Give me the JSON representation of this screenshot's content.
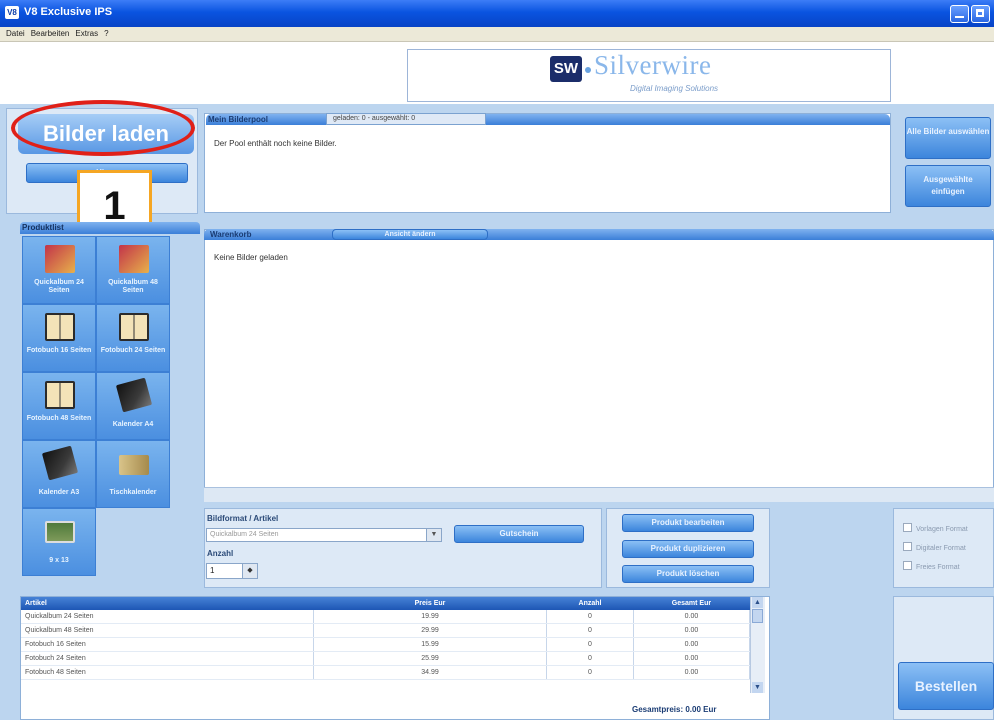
{
  "window": {
    "title": "V8 Exclusive IPS",
    "icon_text": "V8"
  },
  "menu": [
    "Datei",
    "Bearbeiten",
    "Extras",
    "?"
  ],
  "logo": {
    "mark": "SW",
    "name": "Silverwire",
    "tagline": "Digital Imaging Solutions"
  },
  "left_panel": {
    "load_button": "Bilder laden",
    "add_button": "Hinzu",
    "step_badge": "1"
  },
  "product_list": {
    "header": "Produktlist",
    "items": [
      {
        "label": "Quickalbum 24 Seiten",
        "icon": "album-icon"
      },
      {
        "label": "Quickalbum 48 Seiten",
        "icon": "album-icon"
      },
      {
        "label": "Fotobuch 16 Seiten",
        "icon": "photobook-icon"
      },
      {
        "label": "Fotobuch 24 Seiten",
        "icon": "photobook-icon"
      },
      {
        "label": "Fotobuch 48 Seiten",
        "icon": "photobook-icon"
      },
      {
        "label": "Kalender A4",
        "icon": "calendar-icon"
      },
      {
        "label": "Kalender A3",
        "icon": "calendar-icon"
      },
      {
        "label": "Tischkalender",
        "icon": "desk-calendar-icon"
      },
      {
        "label": "9 x 13",
        "icon": "photo-print-icon"
      }
    ]
  },
  "pool": {
    "tab": "Mein Bilderpool",
    "status": "geladen: 0 - ausgewählt: 0",
    "message": "Der Pool enthält noch keine Bilder."
  },
  "side_buttons": {
    "select_all": "Alle Bilder auswählen",
    "add_selected": "Ausgewählte einfügen"
  },
  "cart": {
    "tab": "Warenkorb",
    "view_button": "Ansicht ändern",
    "message": "Keine Bilder geladen"
  },
  "format": {
    "label": "Bildformat / Artikel",
    "selected": "Quickalbum 24 Seiten",
    "voucher_button": "Gutschein",
    "qty_label": "Anzahl",
    "qty_value": "1"
  },
  "actions": {
    "edit": "Produkt bearbeiten",
    "duplicate": "Produkt duplizieren",
    "delete": "Produkt löschen"
  },
  "format_checks": [
    "Vorlagen Format",
    "Digitaler Format",
    "Freies Format"
  ],
  "table": {
    "headers": [
      "Artikel",
      "Preis Eur",
      "Anzahl",
      "Gesamt Eur"
    ],
    "rows": [
      [
        "Quickalbum 24 Seiten",
        "19.99",
        "0",
        "0.00"
      ],
      [
        "Quickalbum 48 Seiten",
        "29.99",
        "0",
        "0.00"
      ],
      [
        "Fotobuch 16 Seiten",
        "15.99",
        "0",
        "0.00"
      ],
      [
        "Fotobuch 24 Seiten",
        "25.99",
        "0",
        "0.00"
      ],
      [
        "Fotobuch 48 Seiten",
        "34.99",
        "0",
        "0.00"
      ]
    ],
    "total": "Gesamtpreis: 0.00 Eur"
  },
  "order_button": "Bestellen",
  "colors": {
    "accent": "#f5a623",
    "highlight": "#e02018",
    "titlebar": "#0a54e0",
    "panel_bg": "#bcd5ef"
  }
}
